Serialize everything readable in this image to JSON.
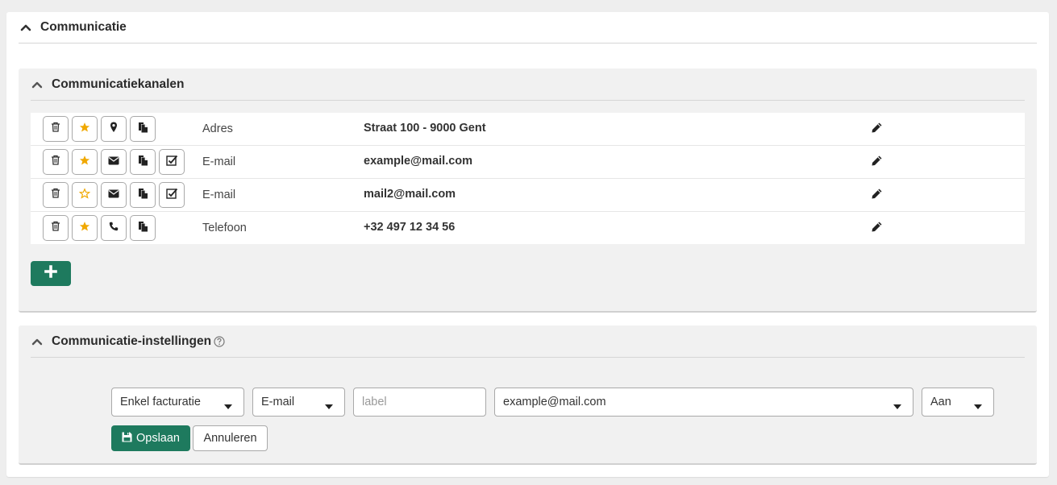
{
  "section": {
    "title": "Communicatie"
  },
  "kanalen": {
    "title": "Communicatiekanalen",
    "rows": [
      {
        "type": "Adres",
        "value": "Straat 100 - 9000 Gent",
        "favorite": true,
        "kind_icon": "map-marker-icon"
      },
      {
        "type": "E-mail",
        "value": "example@mail.com",
        "favorite": true,
        "kind_icon": "envelope-icon"
      },
      {
        "type": "E-mail",
        "value": "mail2@mail.com",
        "favorite": false,
        "kind_icon": "envelope-icon"
      },
      {
        "type": "Telefoon",
        "value": "+32 497 12 34 56",
        "favorite": true,
        "kind_icon": "phone-icon"
      }
    ]
  },
  "instellingen": {
    "title": "Communicatie-instellingen",
    "scope_selected": "Enkel facturatie",
    "channel_selected": "E-mail",
    "label_placeholder": "label",
    "address_selected": "example@mail.com",
    "onoff_selected": "Aan",
    "save_label": "Opslaan",
    "cancel_label": "Annuleren"
  },
  "colors": {
    "accent": "#1e7a5e",
    "star": "#f0a800",
    "panel_bg": "#f1f1f1"
  }
}
